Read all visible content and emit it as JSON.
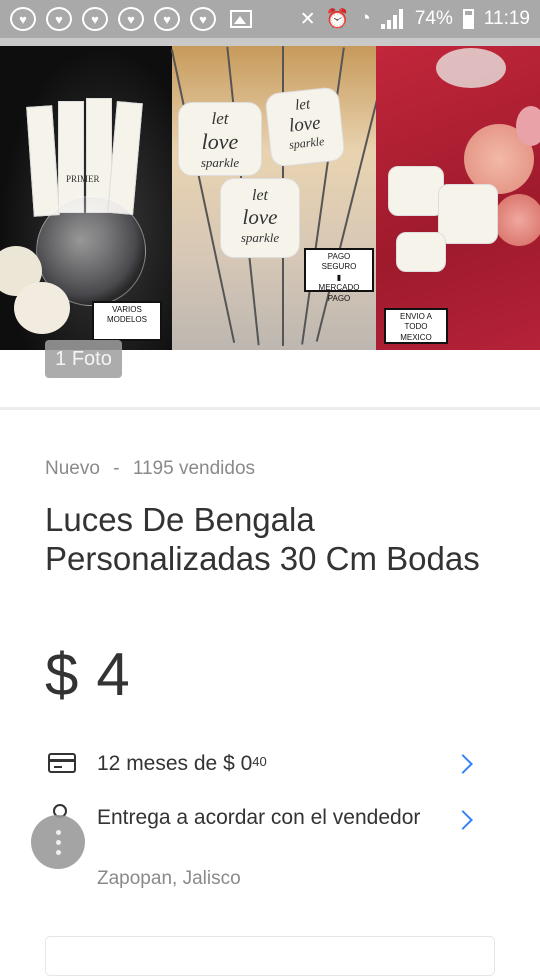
{
  "status_bar": {
    "notification_icons": [
      "heart-icon",
      "heart-icon",
      "heart-icon",
      "heart-icon",
      "heart-icon",
      "heart-icon",
      "gallery-icon"
    ],
    "battery_percent": "74%",
    "time": "11:19",
    "system_icons": [
      "mute-icon",
      "alarm-icon",
      "wifi-icon",
      "signal-icon",
      "battery-icon"
    ]
  },
  "hero": {
    "labels": {
      "varios": "VARIOS MODELOS",
      "pago": "PAGO SEGURO",
      "mercado": "MERCADO PAGO",
      "envio": "ENVIO A TODO MEXICO"
    },
    "card_text": {
      "let": "let",
      "love": "love",
      "sparkle": "sparkle",
      "primer": "PRIMER"
    },
    "photo_count": "1 Foto"
  },
  "product": {
    "condition": "Nuevo",
    "separator": "-",
    "sold": "1195 vendidos",
    "title": "Luces De Bengala Personalizadas 30 Cm Bodas",
    "currency": "$",
    "price": "4"
  },
  "installments": {
    "text": "12 meses de $ 0",
    "cents": "40"
  },
  "shipping": {
    "text": "Entrega a acordar con el vendedor",
    "location": "Zapopan, Jalisco"
  },
  "colors": {
    "status_bar": "#a9a9a9",
    "text_primary": "#333333",
    "text_secondary": "#8a8a8a",
    "accent": "#3483fa"
  }
}
